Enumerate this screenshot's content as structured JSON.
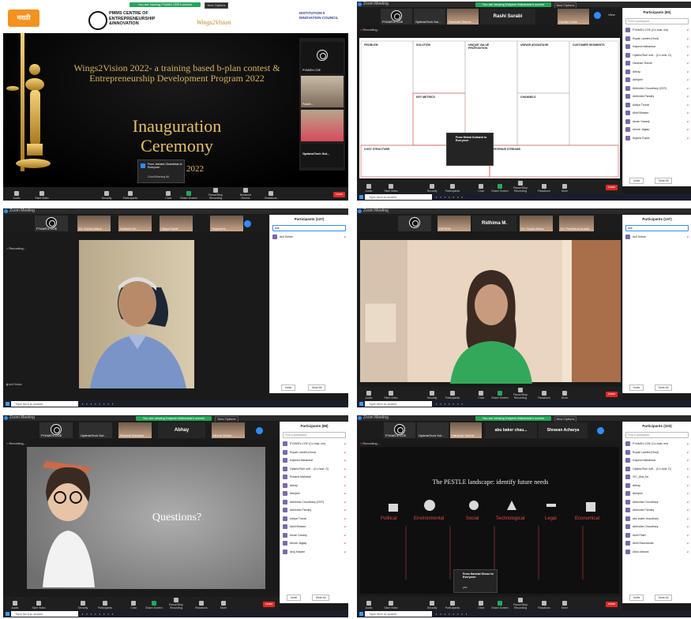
{
  "common": {
    "window_title": "Zoom Meeting",
    "search_placeholder": "Type here to search",
    "new_options": "New Options",
    "invite": "Invite",
    "mute_all": "Mute All",
    "leave": "Leave",
    "view": "View",
    "recording": "Recording...",
    "find_participant": "Find a participant",
    "toolbar": [
      "Audio",
      "Start Video",
      "Security",
      "Participants",
      "Chat",
      "Share Screen",
      "Pause/Stop Recording",
      "Breakout Rooms",
      "Reactions",
      "More"
    ]
  },
  "p1": {
    "left_logo": "मराठी",
    "logo_title": "PMMS CENTRE OF ENTREPRENEURSHIP &INNOVATION",
    "wings_logo": "Wings2Vision",
    "iic_logo": "INSTITUTION'S INNOVATION COUNCIL",
    "headline": "Wings2Vision 2022- a training based b-plan contest & Entrepreneurship Development Program 2022",
    "ceremony_line1": "Inauguration",
    "ceremony_line2": "Ceremony",
    "date_fragment": "2022",
    "green_banner": "You are viewing PYAMS CEE's screen",
    "chat_from": "From Jashant Ghandekar to Everyone:",
    "chat_msg": "Good Morning All",
    "side_tiles": [
      "PYAMS's COE",
      "Palakh...",
      "OptimizTech Sol..."
    ],
    "participants_count": "1"
  },
  "p2": {
    "green_banner": "You are viewing Kalpesh Mahankar's screen",
    "thumb_names": [
      "PYAMS's COE",
      "OptimizTech Sol...",
      "Harshad Shinde",
      "Rashi Surabi",
      "Kavita Limbe"
    ],
    "active_speaker": "Rashi Surabi",
    "canvas_blocks": [
      "PROBLEM",
      "SOLUTION",
      "UNIQUE VALUE PROPOSITION",
      "UNFAIR ADVANTAGE",
      "CUSTOMER SEGMENTS",
      "KEY METRICS",
      "CHANNELS",
      "COST STRUCTURE",
      "REVENUE STREAMS"
    ],
    "chat_from": "From Mrinal Kulkarni to Everyone:",
    "participants_title": "Participants (60)",
    "participants": [
      "PYAMS's COE (Co-host, me)",
      "Rupali Lambhi (Host)",
      "Kalpesh Mahankar",
      "OptimizTech soft... (Co-host, G)",
      "Harshad Shinde",
      "Abhay",
      "Abhijeet",
      "Abhishek Choudhary (ZCR)",
      "Abhishek Pandey",
      "Aditya Thorat",
      "Akhil Bhasan",
      "Aman Garanji",
      "Amole Jagtap",
      "Anjana Gupta"
    ]
  },
  "p3": {
    "thumb_names": [
      "PYAMS's COE",
      "Dr. Sunita Mane",
      "Kalamid Ali...",
      "Vijaya Saraf",
      "Yogendra..."
    ],
    "participants_title": "Participants (137)",
    "search_value": "anil",
    "participants": [
      "Anil Sohan"
    ],
    "recording": "Recording..."
  },
  "p4": {
    "thumb_names": [
      "PYAMS's COE",
      "DIPSHA",
      "Prathna M.",
      "Dr. Sunita Mane",
      "Dr. Prarthana Anand"
    ],
    "active_speaker": "Ridhima M.",
    "participants_title": "Participants (137)",
    "search_value": "anil",
    "participants": [
      "Anil Sohan"
    ]
  },
  "p5": {
    "green_banner": "You are viewing Kalpesh Mahankar's screen",
    "thumb_names": [
      "PYAMS's COE",
      "OptimizTech Sol...",
      "Rohanit Mahabar",
      "Abhay",
      "Mrinal Shirsh..."
    ],
    "active_speaker": "Abhay",
    "slide_text": "Questions?",
    "participants_title": "Participants (88)",
    "participants": [
      "PYAMS's COE (Co-host, me)",
      "Rupali Lambhi (Host)",
      "Kalpesh Mahankar",
      "OptimizTech soft... (Co-host, G)",
      "Rohanit Mahabar",
      "Abhay",
      "Abhijeet",
      "Abhishek Choudhary (ZCR)",
      "Abhishek Pandey",
      "Aditya Thorat",
      "Akhil Bhasan",
      "Aman Garanji",
      "Amole Jagtap",
      "Anuj Kadam"
    ]
  },
  "p6": {
    "green_banner": "You are viewing Kalpesh Mahankar's screen",
    "thumb_names": [
      "PYAMS's COE",
      "OptimizTech Sol...",
      "Harshad Shinde",
      "abu baker chau...",
      "Shravan Acharya"
    ],
    "speakers": [
      "abu baker chau...",
      "Shravan Acharya"
    ],
    "slide_title": "The PESTLE landscape: identify future needs",
    "pestle": [
      "Political",
      "Environmental",
      "Social",
      "Technological",
      "Legal",
      "Economical"
    ],
    "chat_from": "From Harshal Ghose to Everyone:",
    "chat_msg": "yes",
    "participants_title": "Participants (103)",
    "participants": [
      "PYAMS's COE (Co-host, me)",
      "Rupali Lambhi (Host)",
      "Kalpesh Mahankar",
      "OptimizTech soft... (Co-host, G)",
      "VIC_Aha_ba",
      "Abhay",
      "Abhijeet",
      "Abhishek Choudhary",
      "Abhishek Pandey",
      "abu baker chaudhary",
      "Abhishek Chaudhary",
      "Akhil Patel",
      "Akhil Raushanda",
      "Aliza Jatwani"
    ]
  }
}
